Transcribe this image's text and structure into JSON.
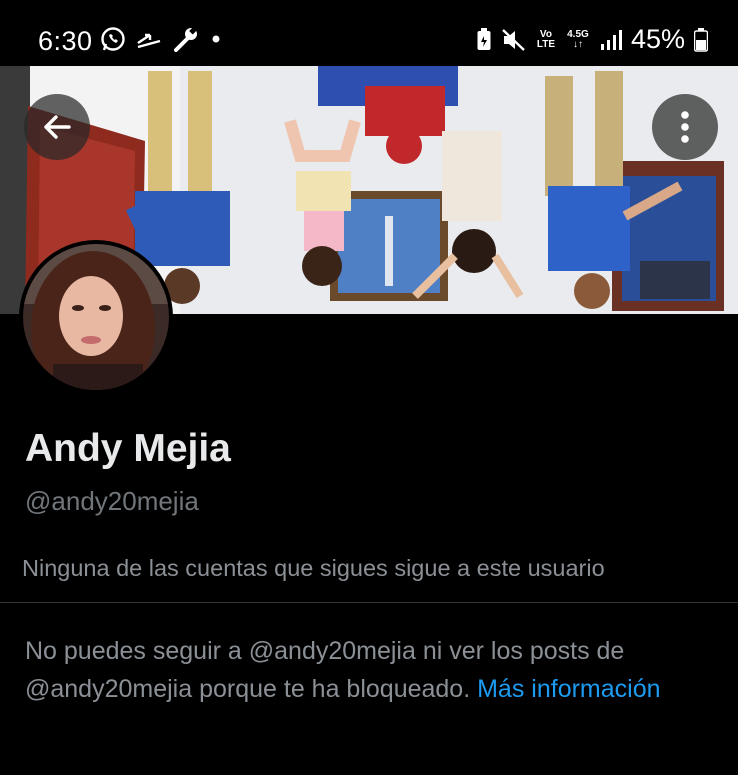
{
  "status_bar": {
    "time": "6:30",
    "battery_percent": "45%",
    "network_volte": "Vo\nLTE",
    "network_type": "4.5G",
    "icons": [
      "whatsapp-icon",
      "missed-call-icon",
      "wrench-icon",
      "dot-icon",
      "battery-saver-icon",
      "mute-icon",
      "signal-icon",
      "battery-icon"
    ]
  },
  "header": {
    "back_icon": "arrow-left-icon",
    "more_icon": "more-vertical-icon"
  },
  "profile": {
    "display_name": "Andy Mejia",
    "username": "@andy20mejia",
    "followers_you_know": "Ninguna de las cuentas que sigues sigue a este usuario",
    "blocked_message": "No puedes seguir a @andy20mejia ni ver los posts de @andy20mejia porque te ha bloqueado.",
    "more_info_link": "Más información"
  },
  "colors": {
    "background": "#000000",
    "text_primary": "#e7e9ea",
    "text_secondary": "#71767b",
    "link": "#1d9bf0",
    "divider": "#2f3336"
  }
}
